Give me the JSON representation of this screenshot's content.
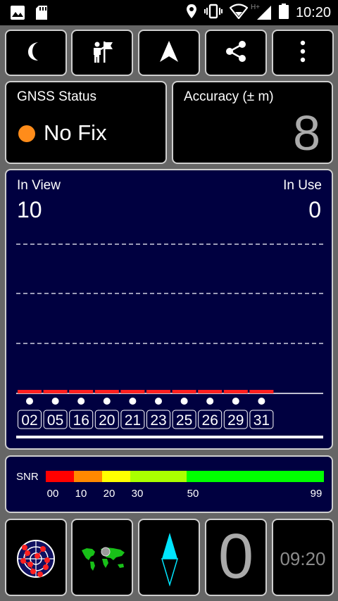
{
  "status_bar": {
    "time": "10:20",
    "network_type": "H+",
    "icons": [
      "image-icon",
      "sd-card-icon",
      "location-pin-icon",
      "vibrate-icon",
      "wifi-icon",
      "signal-icon",
      "battery-icon"
    ]
  },
  "toolbar": {
    "buttons": [
      "night-mode-icon",
      "tracking-icon",
      "navigate-arrow-icon",
      "share-icon",
      "more-vert-icon"
    ]
  },
  "gnss": {
    "title": "GNSS Status",
    "status": "No Fix",
    "status_color": "#ff8c1a"
  },
  "accuracy": {
    "title": "Accuracy (± m)",
    "value": "8"
  },
  "satellites": {
    "in_view_label": "In View",
    "in_view_value": "10",
    "in_use_label": "In Use",
    "in_use_value": "0",
    "ids": [
      "02",
      "05",
      "16",
      "20",
      "21",
      "23",
      "25",
      "26",
      "29",
      "31"
    ],
    "bar_color": "#ff2020"
  },
  "snr": {
    "label": "SNR",
    "ticks": [
      "00",
      "10",
      "20",
      "30",
      "50",
      "99"
    ],
    "colors": [
      "#ff0000",
      "#ff8800",
      "#ffff00",
      "#aaff00",
      "#00ff00"
    ]
  },
  "bottom": {
    "compass_value": "0",
    "time_value": "09:20"
  }
}
